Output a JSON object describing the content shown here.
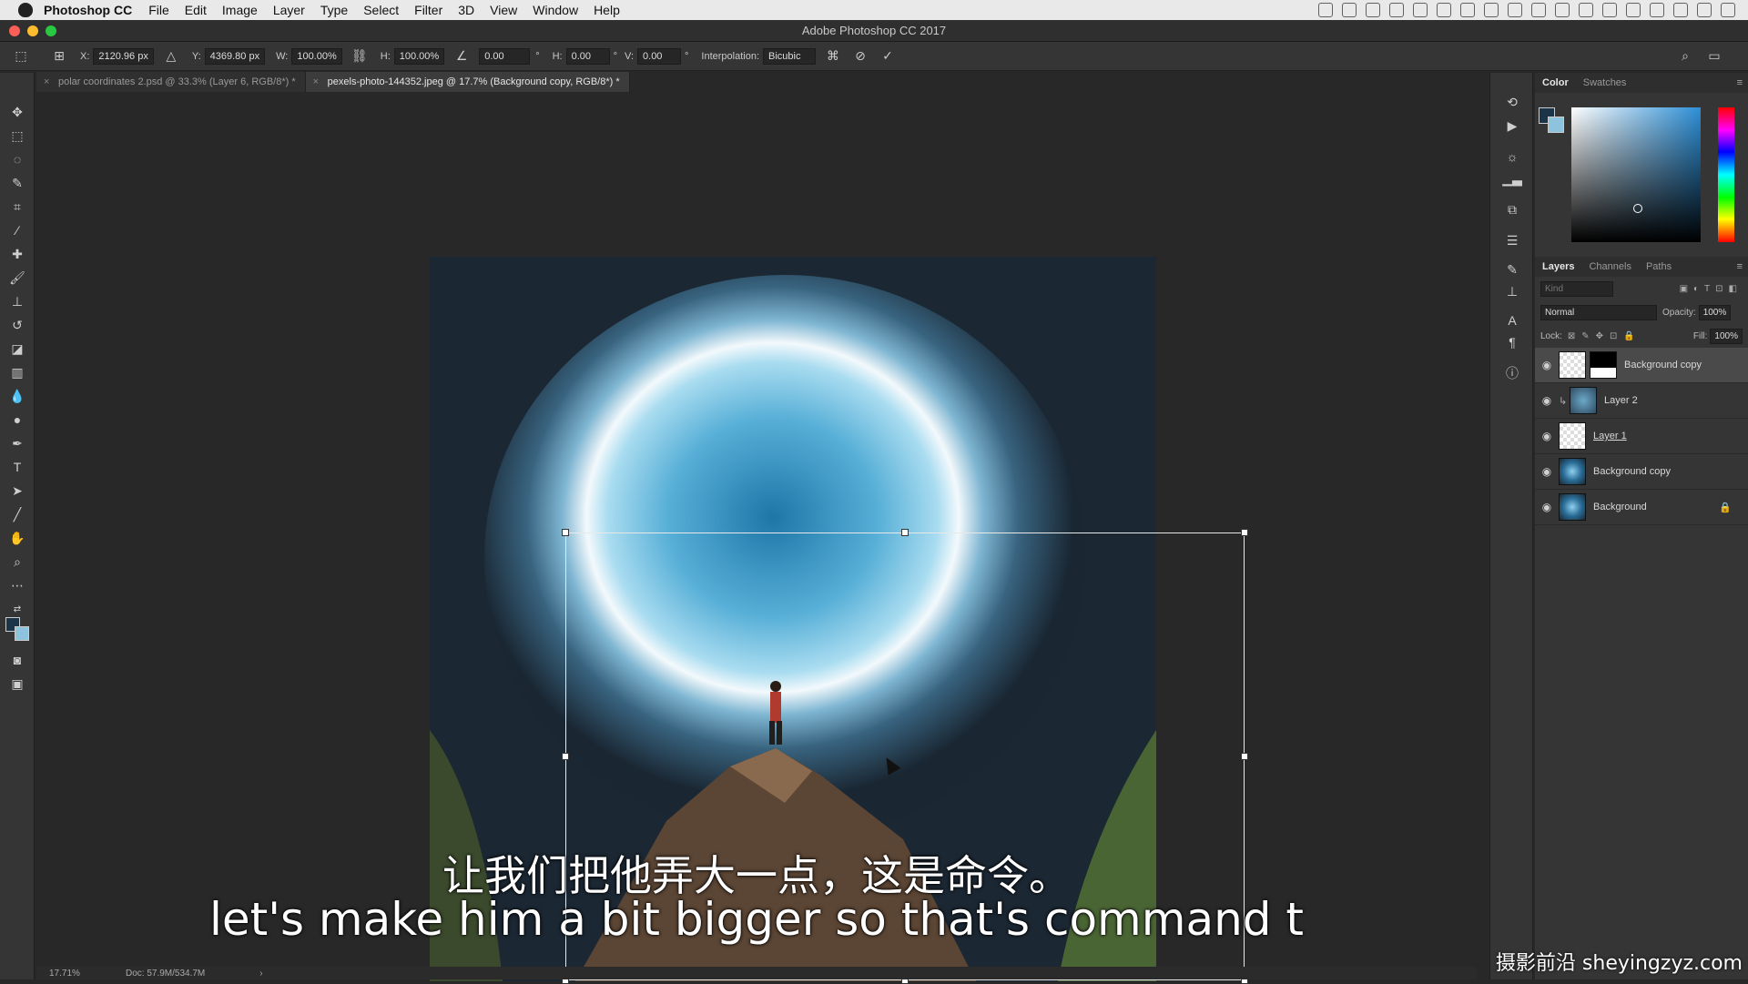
{
  "menubar": {
    "app_name": "Photoshop CC",
    "items": [
      "File",
      "Edit",
      "Image",
      "Layer",
      "Type",
      "Select",
      "Filter",
      "3D",
      "View",
      "Window",
      "Help"
    ]
  },
  "window": {
    "title": "Adobe Photoshop CC 2017"
  },
  "options": {
    "x_label": "X:",
    "x_value": "2120.96 px",
    "y_label": "Y:",
    "y_value": "4369.80 px",
    "w_label": "W:",
    "w_value": "100.00%",
    "h_label": "H:",
    "h_value": "100.00%",
    "angle_value": "0.00",
    "hskew_label": "H:",
    "hskew_value": "0.00",
    "vskew_label": "V:",
    "vskew_value": "0.00",
    "interp_label": "Interpolation:",
    "interp_value": "Bicubic"
  },
  "tabs": [
    {
      "label": "polar coordinates 2.psd @ 33.3% (Layer 6, RGB/8*) *"
    },
    {
      "label": "pexels-photo-144352.jpeg @ 17.7% (Background copy, RGB/8*) *"
    }
  ],
  "subtitles": {
    "chinese": "让我们把他弄大一点，这是命令。",
    "english": "let's make him a bit bigger so that's command t"
  },
  "status": {
    "zoom": "17.71%",
    "doc": "Doc: 57.9M/534.7M"
  },
  "color_panel": {
    "tab_color": "Color",
    "tab_swatches": "Swatches"
  },
  "layers_panel": {
    "tab_layers": "Layers",
    "tab_channels": "Channels",
    "tab_paths": "Paths",
    "kind_placeholder": "Kind",
    "blend_mode": "Normal",
    "opacity_label": "Opacity:",
    "opacity_value": "100%",
    "lock_label": "Lock:",
    "fill_label": "Fill:",
    "fill_value": "100%",
    "layers": [
      {
        "name": "Background copy"
      },
      {
        "name": "Layer 2"
      },
      {
        "name": "Layer 1"
      },
      {
        "name": "Background copy"
      },
      {
        "name": "Background"
      }
    ]
  },
  "watermark": "摄影前沿 sheyingzyz.com"
}
